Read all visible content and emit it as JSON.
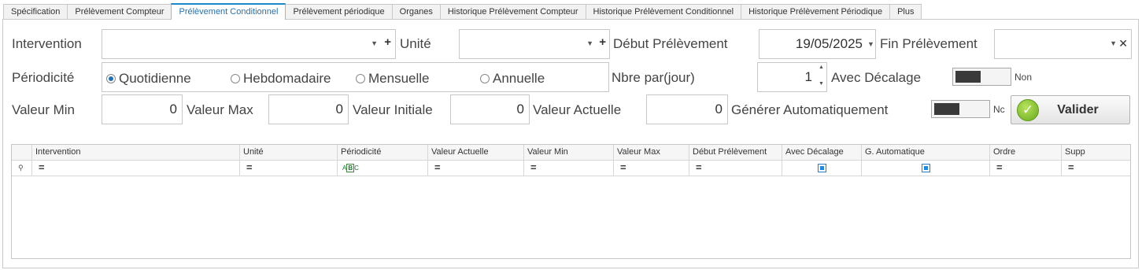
{
  "tabs": [
    "Spécification",
    "Prélèvement Compteur",
    "Prélèvement Conditionnel",
    "Prélèvement périodique",
    "Organes",
    "Historique Prélèvement Compteur",
    "Historique Prélèvement Conditionnel",
    "Historique Prélèvement Périodique",
    "Plus"
  ],
  "active_tab": "Prélèvement Conditionnel",
  "form": {
    "intervention_label": "Intervention",
    "intervention_value": "",
    "unite_label": "Unité",
    "unite_value": "",
    "debut_label": "Début Prélèvement",
    "debut_value": "19/05/2025",
    "fin_label": "Fin Prélèvement",
    "fin_value": "",
    "periodicite_label": "Périodicité",
    "periodicite_options": [
      "Quotidienne",
      "Hebdomadaire",
      "Mensuelle",
      "Annuelle"
    ],
    "periodicite_selected": "Quotidienne",
    "nbre_label": "Nbre par(jour)",
    "nbre_value": "1",
    "decalage_label": "Avec Décalage",
    "decalage_state": "Non",
    "valeur_min_label": "Valeur Min",
    "valeur_min_value": "0",
    "valeur_max_label": "Valeur Max",
    "valeur_max_value": "0",
    "valeur_initiale_label": "Valeur Initiale",
    "valeur_initiale_value": "0",
    "valeur_actuelle_label": "Valeur Actuelle",
    "valeur_actuelle_value": "0",
    "generer_label": "Générer Automatiquement",
    "generer_state": "Nc",
    "valider_label": "Valider"
  },
  "grid": {
    "columns": [
      "Intervention",
      "Unité",
      "Périodicité",
      "Valeur Actuelle",
      "Valeur Min",
      "Valeur Max",
      "Début Prélèvement",
      "Avec Décalage",
      "G. Automatique",
      "Ordre",
      "Supp"
    ],
    "filter_row": {
      "equals_symbol": "=",
      "abc_symbol": "ABC"
    }
  },
  "icons": {
    "combo_arrow": "dropdown-arrow-icon",
    "add": "plus-icon",
    "clear": "x-icon",
    "check": "checkmark-icon",
    "pin": "pin-icon"
  },
  "colors": {
    "accent": "#1e73b8",
    "toggle_knob": "#3a3a3a",
    "check_green": "#6aaa1c"
  }
}
